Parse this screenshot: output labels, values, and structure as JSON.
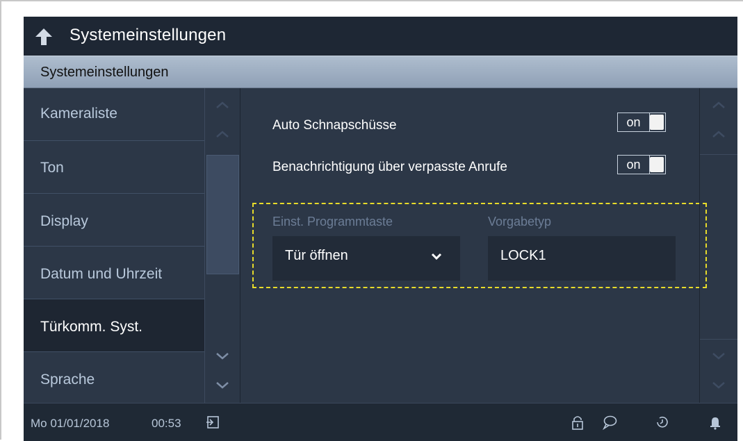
{
  "header": {
    "title": "Systemeinstellungen",
    "back_icon": "back-arrow-icon"
  },
  "subheader": {
    "label": "Systemeinstellungen"
  },
  "sidebar": {
    "items": [
      {
        "label": "Kameraliste",
        "active": false
      },
      {
        "label": "Ton",
        "active": false
      },
      {
        "label": "Display",
        "active": false
      },
      {
        "label": "Datum und Uhrzeit",
        "active": false
      },
      {
        "label": "Türkomm. Syst.",
        "active": true
      },
      {
        "label": "Sprache",
        "active": false
      }
    ]
  },
  "content": {
    "auto_snapshots": {
      "label": "Auto Schnapschüsse",
      "toggle": "on"
    },
    "missed_calls": {
      "label": "Benachrichtigung über verpasste Anrufe",
      "toggle": "on"
    },
    "program_key": {
      "label": "Einst. Programmtaste",
      "value": "Tür öffnen"
    },
    "default_type": {
      "label": "Vorgabetyp",
      "value": "LOCK1"
    }
  },
  "statusbar": {
    "date": "Mo 01/01/2018",
    "time": "00:53",
    "icons": [
      "exit-icon",
      "lock-icon",
      "chat-icon",
      "history-icon",
      "bell-icon"
    ]
  },
  "colors": {
    "background": "#2c3747",
    "topbar": "#1e2734",
    "active_item": "#1e2632",
    "highlight": "#e8dc2a"
  }
}
